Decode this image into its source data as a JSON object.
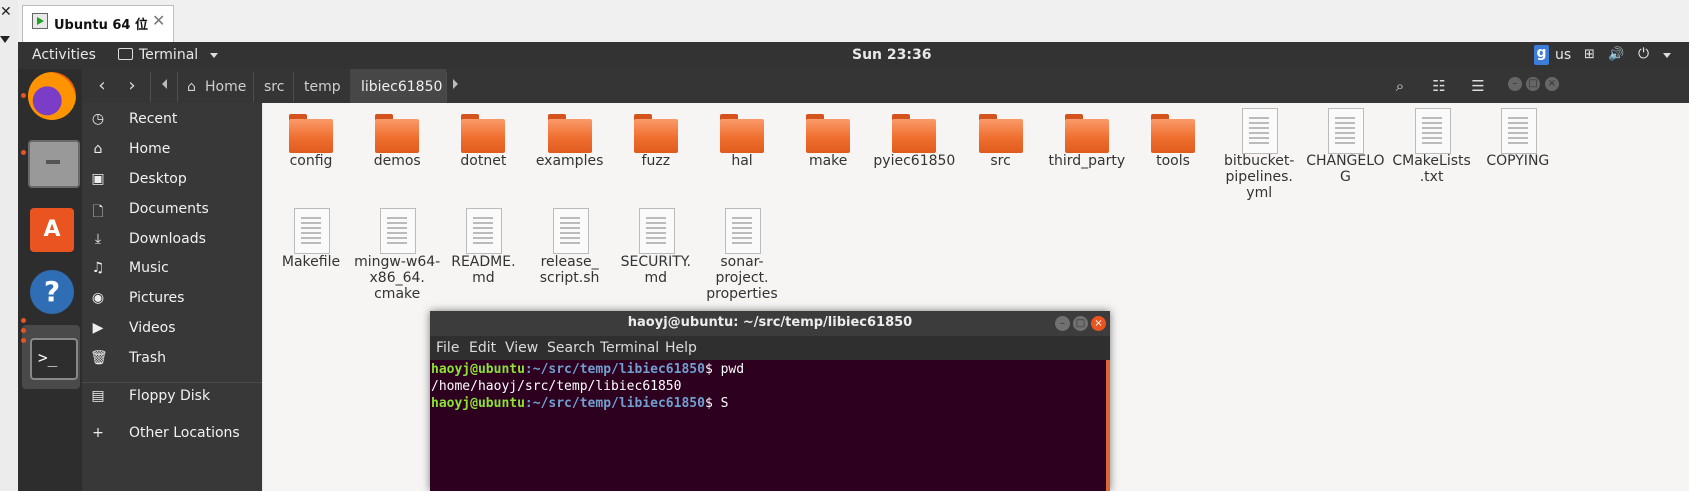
{
  "vm_tab": {
    "title": "Ubuntu 64 位",
    "close": "✕"
  },
  "host": {
    "close": "✕"
  },
  "topbar": {
    "activities": "Activities",
    "app_menu": "Terminal",
    "clock": "Sun 23:36",
    "input_icon": "g",
    "input_lang": "us",
    "icons": [
      "network-icon",
      "volume-icon",
      "power-icon"
    ]
  },
  "dock": {
    "apps": [
      "firefox",
      "files",
      "ubuntu-software",
      "help",
      "terminal"
    ]
  },
  "files": {
    "breadcrumb": [
      "Home",
      "src",
      "temp",
      "libiec61850"
    ],
    "sidebar": [
      {
        "label": "Recent",
        "icon": "◷"
      },
      {
        "label": "Home",
        "icon": "⌂"
      },
      {
        "label": "Desktop",
        "icon": "▣"
      },
      {
        "label": "Documents",
        "icon": "🗋"
      },
      {
        "label": "Downloads",
        "icon": "⤓"
      },
      {
        "label": "Music",
        "icon": "♫"
      },
      {
        "label": "Pictures",
        "icon": "◉"
      },
      {
        "label": "Videos",
        "icon": "▶"
      },
      {
        "label": "Trash",
        "icon": "🗑"
      },
      {
        "label": "Floppy Disk",
        "icon": "▤"
      },
      {
        "label": "Other Locations",
        "icon": "+"
      }
    ],
    "items": [
      {
        "name": "config",
        "kind": "folder"
      },
      {
        "name": "demos",
        "kind": "folder"
      },
      {
        "name": "dotnet",
        "kind": "folder"
      },
      {
        "name": "examples",
        "kind": "folder"
      },
      {
        "name": "fuzz",
        "kind": "folder"
      },
      {
        "name": "hal",
        "kind": "folder"
      },
      {
        "name": "make",
        "kind": "folder"
      },
      {
        "name": "pyiec61850",
        "kind": "folder"
      },
      {
        "name": "src",
        "kind": "folder"
      },
      {
        "name": "third_party",
        "kind": "folder"
      },
      {
        "name": "tools",
        "kind": "folder"
      },
      {
        "name": "bitbucket-\npipelines.\nyml",
        "kind": "file"
      },
      {
        "name": "CHANGELO\nG",
        "kind": "file"
      },
      {
        "name": "CMakeLists\n.txt",
        "kind": "file"
      },
      {
        "name": "COPYING",
        "kind": "file"
      },
      {
        "name": "Makefile",
        "kind": "file"
      },
      {
        "name": "mingw-w64-\nx86_64.\ncmake",
        "kind": "file"
      },
      {
        "name": "README.\nmd",
        "kind": "file"
      },
      {
        "name": "release_\nscript.sh",
        "kind": "file"
      },
      {
        "name": "SECURITY.\nmd",
        "kind": "file"
      },
      {
        "name": "sonar-\nproject.\nproperties",
        "kind": "file"
      }
    ]
  },
  "terminal": {
    "title": "haoyj@ubuntu: ~/src/temp/libiec61850",
    "menu": [
      "File",
      "Edit",
      "View",
      "Search",
      "Terminal",
      "Help"
    ],
    "lines": [
      {
        "user": "haoyj@ubuntu",
        "path": ":~/src/temp/libiec61850",
        "cmd": "$ pwd"
      },
      {
        "output": "/home/haoyj/src/temp/libiec61850"
      },
      {
        "user": "haoyj@ubuntu",
        "path": ":~/src/temp/libiec61850",
        "cmd": "$ S"
      }
    ]
  }
}
